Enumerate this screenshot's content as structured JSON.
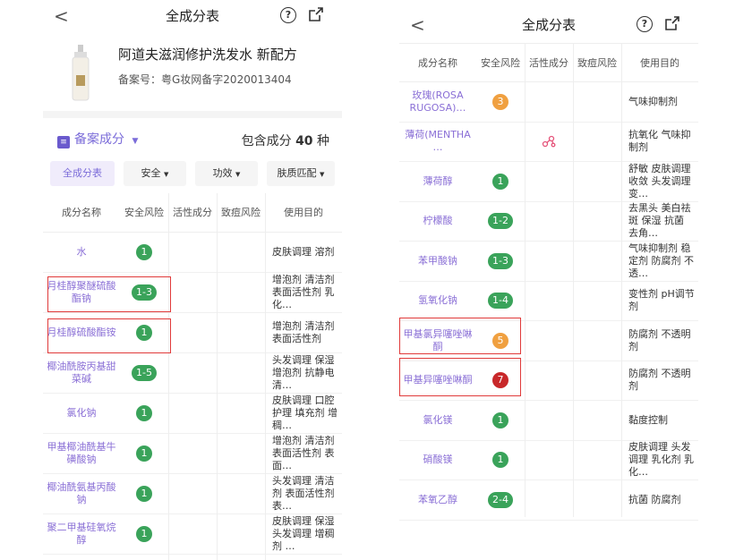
{
  "left": {
    "nav_title": "全成分表",
    "product": {
      "name": "阿道夫滋润修护洗发水 新配方",
      "registration": "备案号：粤G妆网备字2020013404"
    },
    "filing": {
      "label": "备案成分",
      "count_prefix": "包含成分",
      "count": "40",
      "count_suffix": "种"
    },
    "filters": [
      "全成分表",
      "安全",
      "功效",
      "肤质匹配"
    ],
    "headers": [
      "成分名称",
      "安全风险",
      "活性成分",
      "致痘风险",
      "使用目的"
    ],
    "rows": [
      {
        "name": "水",
        "risk": "1",
        "color": "g",
        "purpose": "皮肤调理 溶剂"
      },
      {
        "name": "月桂醇聚醚硫酸酯钠",
        "risk": "1-3",
        "color": "g",
        "purpose": "增泡剂 清洁剂 表面活性剂 乳化…"
      },
      {
        "name": "月桂醇硫酸酯铵",
        "risk": "1",
        "color": "g",
        "purpose": "增泡剂 清洁剂 表面活性剂"
      },
      {
        "name": "椰油酰胺丙基甜菜碱",
        "risk": "1-5",
        "color": "g",
        "purpose": "头发调理 保湿 增泡剂 抗静电 清…"
      },
      {
        "name": "氯化钠",
        "risk": "1",
        "color": "g",
        "purpose": "皮肤调理 口腔护理 填充剂 增稠…"
      },
      {
        "name": "甲基椰油酰基牛磺酸钠",
        "risk": "1",
        "color": "g",
        "purpose": "增泡剂 清洁剂 表面活性剂 表面…"
      },
      {
        "name": "椰油酰氨基丙酸钠",
        "risk": "1",
        "color": "g",
        "purpose": "头发调理 清洁剂 表面活性剂 表…"
      },
      {
        "name": "聚二甲基硅氧烷醇",
        "risk": "1",
        "color": "g",
        "purpose": "皮肤调理 保湿 头发调理 增稠剂 …"
      }
    ]
  },
  "right": {
    "nav_title": "全成分表",
    "headers": [
      "成分名称",
      "安全风险",
      "活性成分",
      "致痘风险",
      "使用目的"
    ],
    "rows": [
      {
        "name": "玫瑰(ROSA RUGOSA)…",
        "risk": "3",
        "color": "o",
        "active": "",
        "purpose": "气味抑制剂"
      },
      {
        "name": "薄荷(MENTHA …",
        "risk": "",
        "color": "",
        "active": "active-icon",
        "purpose": "抗氧化 气味抑制剂"
      },
      {
        "name": "薄荷醇",
        "risk": "1",
        "color": "g",
        "active": "",
        "purpose": "舒敏 皮肤调理 收敛 头发调理 变…"
      },
      {
        "name": "柠檬酸",
        "risk": "1-2",
        "color": "g",
        "active": "",
        "purpose": "去黑头 美白祛斑 保湿 抗菌 去角…"
      },
      {
        "name": "苯甲酸钠",
        "risk": "1-3",
        "color": "g",
        "active": "",
        "purpose": "气味抑制剂 稳定剂 防腐剂 不透…"
      },
      {
        "name": "氢氧化钠",
        "risk": "1-4",
        "color": "g",
        "active": "",
        "purpose": "变性剂 pH调节剂"
      },
      {
        "name": "甲基氯异噻唑啉酮",
        "risk": "5",
        "color": "o",
        "active": "",
        "purpose": "防腐剂 不透明剂"
      },
      {
        "name": "甲基异噻唑啉酮",
        "risk": "7",
        "color": "r",
        "active": "",
        "purpose": "防腐剂 不透明剂"
      },
      {
        "name": "氯化镁",
        "risk": "1",
        "color": "g",
        "active": "",
        "purpose": "黏度控制"
      },
      {
        "name": "硝酸镁",
        "risk": "1",
        "color": "g",
        "active": "",
        "purpose": "皮肤调理 头发调理 乳化剂 乳化…"
      },
      {
        "name": "苯氧乙醇",
        "risk": "2-4",
        "color": "g",
        "active": "",
        "purpose": "抗菌 防腐剂"
      }
    ]
  },
  "icons": {
    "back": "chevron-left-icon",
    "help": "help-circle-icon",
    "share": "share-icon",
    "active": "molecule-icon"
  },
  "colors": {
    "accent": "#7b6cd9",
    "low_risk": "#3aa35a",
    "mid_risk": "#f0a040",
    "high_risk": "#c8282a",
    "highlight": "#e03a3a"
  },
  "help_glyph": "?",
  "back_glyph": "<"
}
